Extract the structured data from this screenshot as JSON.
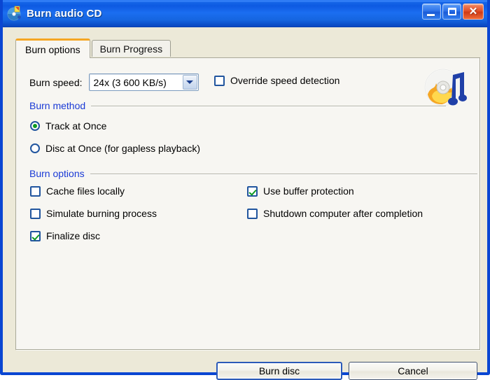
{
  "window": {
    "title": "Burn audio CD",
    "icon": "audio-cd-icon",
    "controls": {
      "minimize": "Minimize",
      "maximize": "Maximize",
      "close": "Close",
      "close_glyph": "✕"
    }
  },
  "tabs": [
    {
      "label": "Burn options",
      "active": true
    },
    {
      "label": "Burn Progress",
      "active": false
    }
  ],
  "panel": {
    "burn_speed": {
      "label": "Burn speed:",
      "value": "24x (3 600 KB/s)",
      "dropdown_icon": "chevron-down-icon"
    },
    "override": {
      "label": "Override speed detection",
      "checked": false
    },
    "disc_icon": "audio-cd-flames-icon",
    "burn_method": {
      "title": "Burn method",
      "options": [
        {
          "label": "Track at Once",
          "selected": true
        },
        {
          "label": "Disc at Once (for gapless playback)",
          "selected": false
        }
      ]
    },
    "burn_options": {
      "title": "Burn options",
      "left": [
        {
          "label": "Cache files locally",
          "checked": false
        },
        {
          "label": "Simulate burning process",
          "checked": false
        },
        {
          "label": "Finalize disc",
          "checked": true
        }
      ],
      "right": [
        {
          "label": "Use buffer protection",
          "checked": true
        },
        {
          "label": "Shutdown computer after completion",
          "checked": false
        }
      ]
    }
  },
  "footer": {
    "primary_button": "Burn disc",
    "secondary_button": "Cancel"
  },
  "colors": {
    "titlebar_blue": "#1565E8",
    "frame_blue": "#0A46D2",
    "dialog_bg": "#ECE9D8",
    "panel_bg": "#F7F6F2",
    "section_heading": "#1A3AD6",
    "active_tab_accent": "#F5A623",
    "check_green": "#0D9A22",
    "control_border_blue": "#21559E"
  }
}
